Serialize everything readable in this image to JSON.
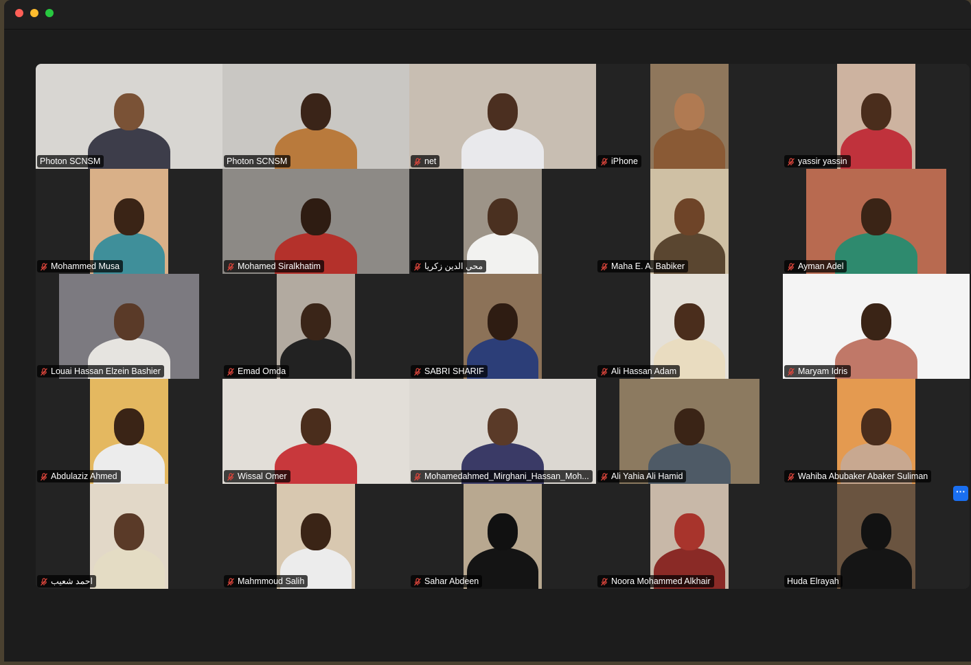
{
  "window": {
    "controls": [
      "close",
      "minimize",
      "zoom"
    ]
  },
  "more_button": {
    "label": "···"
  },
  "participants": [
    {
      "name": "Photon SCNSM",
      "muted": false,
      "active": false,
      "video": "full",
      "bg": "#d8d6d2",
      "skin": "#7a5236",
      "shirt": "#3d3d4a"
    },
    {
      "name": "Photon SCNSM",
      "muted": false,
      "active": true,
      "video": "full",
      "bg": "#c9c7c3",
      "skin": "#3a2418",
      "shirt": "#b97a3c"
    },
    {
      "name": "net",
      "muted": true,
      "active": false,
      "video": "full",
      "bg": "#c8beb2",
      "skin": "#4b2f20",
      "shirt": "#e9e9ec"
    },
    {
      "name": "iPhone",
      "muted": true,
      "active": false,
      "video": "narrow",
      "bg": "#8f775c",
      "skin": "#b07a52",
      "shirt": "#8a5a35"
    },
    {
      "name": "yassir yassin",
      "muted": true,
      "active": false,
      "video": "narrow",
      "bg": "#cdb3a0",
      "skin": "#4a2d1c",
      "shirt": "#c0323c"
    },
    {
      "name": "Mohammed Musa",
      "muted": true,
      "active": false,
      "video": "narrow",
      "bg": "#d9b088",
      "skin": "#3a2416",
      "shirt": "#3f8f9a"
    },
    {
      "name": "Mohamed Siralkhatim",
      "muted": true,
      "active": false,
      "video": "full",
      "bg": "#8d8a86",
      "skin": "#2e1c12",
      "shirt": "#b4312b"
    },
    {
      "name": "محي الدين زكريا",
      "muted": true,
      "active": false,
      "video": "narrow",
      "bg": "#9d9488",
      "skin": "#4a3020",
      "shirt": "#f2f2f0"
    },
    {
      "name": "Maha E. A. Babiker",
      "muted": true,
      "active": false,
      "video": "narrow",
      "bg": "#cfc0a4",
      "skin": "#6e4428",
      "shirt": "#5a4630"
    },
    {
      "name": "Ayman Adel",
      "muted": true,
      "active": false,
      "video": "wide",
      "bg": "#b86a50",
      "skin": "#3a2416",
      "shirt": "#2e8a6e"
    },
    {
      "name": "Louai Hassan Elzein Bashier",
      "muted": true,
      "active": false,
      "video": "wide",
      "bg": "#7c7a80",
      "skin": "#5a3a28",
      "shirt": "#e6e4e0"
    },
    {
      "name": "Emad Omda",
      "muted": true,
      "active": false,
      "video": "narrow",
      "bg": "#b2aaa0",
      "skin": "#3a2518",
      "shirt": "#222222"
    },
    {
      "name": "SABRI SHARIF",
      "muted": true,
      "active": false,
      "video": "narrow",
      "bg": "#8c7258",
      "skin": "#2e1c12",
      "shirt": "#2c3e78"
    },
    {
      "name": "Ali Hassan Adam",
      "muted": true,
      "active": false,
      "video": "narrow",
      "bg": "#e4e0d8",
      "skin": "#4a2d1c",
      "shirt": "#e9dcc0"
    },
    {
      "name": "Maryam Idris",
      "muted": true,
      "active": false,
      "video": "full",
      "bg": "#f4f4f4",
      "skin": "#3a2416",
      "shirt": "#c07868"
    },
    {
      "name": "Abdulaziz Ahmed",
      "muted": true,
      "active": false,
      "video": "narrow",
      "bg": "#e4b860",
      "skin": "#3a2416",
      "shirt": "#ececec"
    },
    {
      "name": "Wissal Omer",
      "muted": true,
      "active": false,
      "video": "full",
      "bg": "#e2ded8",
      "skin": "#4a2d1c",
      "shirt": "#c8383c"
    },
    {
      "name": "Mohamedahmed_Mirghani_Hassan_Moh...",
      "muted": true,
      "active": false,
      "video": "full",
      "bg": "#dcd8d2",
      "skin": "#5a3a28",
      "shirt": "#3a3a66"
    },
    {
      "name": "Ali Yahia Ali Hamid",
      "muted": true,
      "active": false,
      "video": "wide",
      "bg": "#8c7a60",
      "skin": "#3a2416",
      "shirt": "#4e5a66"
    },
    {
      "name": "Wahiba Abubaker Abaker Suliman",
      "muted": true,
      "active": false,
      "video": "narrow",
      "bg": "#e49a50",
      "skin": "#4a2d1c",
      "shirt": "#c8a890"
    },
    {
      "name": "احمد شعيب",
      "muted": true,
      "active": false,
      "video": "narrow",
      "bg": "#e2d8c8",
      "skin": "#5a3a28",
      "shirt": "#e4dcc4"
    },
    {
      "name": "Mahmmoud Salih",
      "muted": true,
      "active": false,
      "video": "narrow",
      "bg": "#d8c8b0",
      "skin": "#3a2416",
      "shirt": "#ececec"
    },
    {
      "name": "Sahar Abdeen",
      "muted": true,
      "active": false,
      "video": "narrow",
      "bg": "#b8a890",
      "skin": "#111111",
      "shirt": "#141414"
    },
    {
      "name": "Noora Mohammed Alkhair",
      "muted": true,
      "active": false,
      "video": "narrow",
      "bg": "#c8b8a8",
      "skin": "#a8342c",
      "shirt": "#8a2a26"
    },
    {
      "name": "Huda Elrayah",
      "muted": false,
      "active": false,
      "video": "narrow",
      "bg": "#6a5440",
      "skin": "#121212",
      "shirt": "#151515"
    }
  ]
}
